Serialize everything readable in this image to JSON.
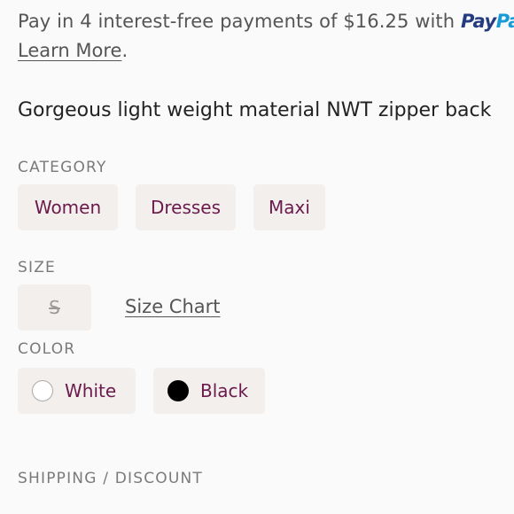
{
  "paypal": {
    "text": "Pay in 4 interest-free payments of $16.25 with ",
    "logo_pay": "Pay",
    "logo_pal": "Pal",
    "after_logo": ".",
    "learn_more": "Learn More",
    "learn_more_after": "."
  },
  "description": "Gorgeous light weight material NWT zipper back",
  "category": {
    "label": "CATEGORY",
    "items": [
      "Women",
      "Dresses",
      "Maxi"
    ]
  },
  "size": {
    "label": "SIZE",
    "value": "S",
    "size_chart": "Size Chart"
  },
  "color": {
    "label": "COLOR",
    "items": [
      {
        "name": "White",
        "swatch": "#ffffff"
      },
      {
        "name": "Black",
        "swatch": "#000000"
      }
    ]
  },
  "shipping": {
    "label": "SHIPPING / DISCOUNT"
  }
}
